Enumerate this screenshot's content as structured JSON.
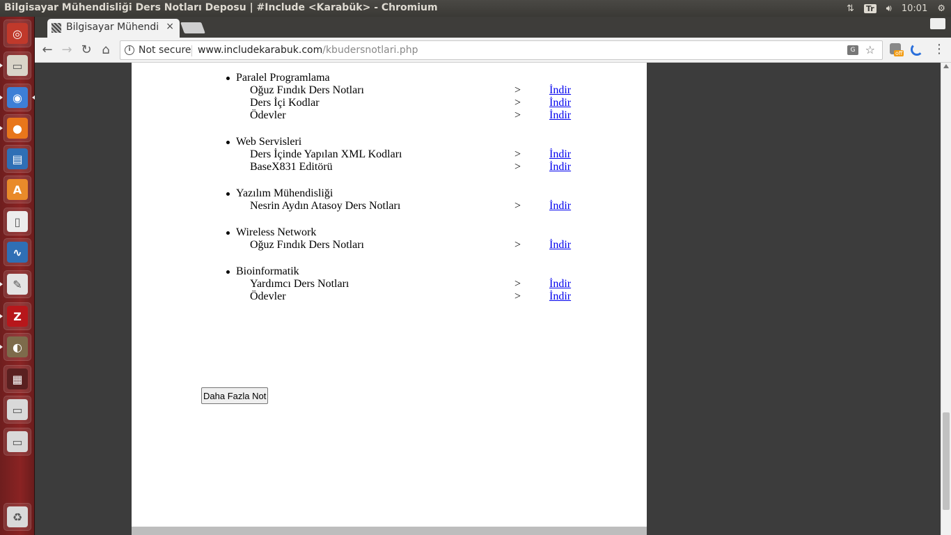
{
  "window": {
    "title": "Bilgisayar Mühendisliği Ders Notları Deposu | #Include <Karabük> - Chromium"
  },
  "system_tray": {
    "keyboard": "Tr",
    "volume_icon": "volume-icon",
    "network_icon": "network-icon",
    "time": "10:01",
    "settings_icon": "gear-icon"
  },
  "launcher": {
    "items": [
      {
        "name": "ubuntu-dash",
        "icon": "ubuntu-logo-icon",
        "color": "#c0392b"
      },
      {
        "name": "files",
        "icon": "files-icon",
        "color": "#d9d4c8"
      },
      {
        "name": "chromium",
        "icon": "chromium-icon",
        "color": "#3d7fd6"
      },
      {
        "name": "firefox",
        "icon": "firefox-icon",
        "color": "#e8761b"
      },
      {
        "name": "libreoffice-writer",
        "icon": "writer-icon",
        "color": "#2f6fb5"
      },
      {
        "name": "software-center",
        "icon": "software-center-icon",
        "color": "#e98a2a"
      },
      {
        "name": "mouse-settings",
        "icon": "mouse-icon",
        "color": "#ececec"
      },
      {
        "name": "system-monitor",
        "icon": "system-monitor-icon",
        "color": "#2f6fb5"
      },
      {
        "name": "text-editor",
        "icon": "text-editor-icon",
        "color": "#e4e4e4"
      },
      {
        "name": "filezilla",
        "icon": "filezilla-icon",
        "color": "#b7171b"
      },
      {
        "name": "gimp",
        "icon": "gimp-icon",
        "color": "#7d6b4b"
      },
      {
        "name": "workspace-switcher",
        "icon": "workspace-icon",
        "color": "#5a2020"
      },
      {
        "name": "drive-1",
        "icon": "drive-icon",
        "color": "#d9d9d9"
      },
      {
        "name": "drive-2",
        "icon": "drive-icon",
        "color": "#d9d9d9"
      },
      {
        "name": "trash",
        "icon": "trash-icon",
        "color": "#d9d9d9"
      }
    ]
  },
  "browser": {
    "tab": {
      "label": "Bilgisayar Mühendi",
      "close": "×"
    },
    "profile": "👤",
    "omnibox": {
      "security": "Not secure",
      "host": "www.includekarabuk.com",
      "path": "/kbudersnotlari.php",
      "translate": "G",
      "star": "☆"
    },
    "extensions": {
      "off_badge": "off"
    },
    "menu": "⋮"
  },
  "content": {
    "categories": [
      {
        "name": "Paralel Programlama",
        "items": [
          {
            "name": "Oğuz Fındık Ders Notları",
            "arrow": ">",
            "link": "İndir"
          },
          {
            "name": "Ders İçi Kodlar",
            "arrow": ">",
            "link": "İndir"
          },
          {
            "name": "Ödevler",
            "arrow": ">",
            "link": "İndir"
          }
        ]
      },
      {
        "name": "Web Servisleri",
        "items": [
          {
            "name": "Ders İçinde Yapılan XML Kodları",
            "arrow": ">",
            "link": "İndir"
          },
          {
            "name": "BaseX831 Editörü",
            "arrow": ">",
            "link": "İndir"
          }
        ]
      },
      {
        "name": "Yazılım Mühendisliği",
        "items": [
          {
            "name": "Nesrin Aydın Atasoy Ders Notları",
            "arrow": ">",
            "link": "İndir"
          }
        ]
      },
      {
        "name": "Wireless Network",
        "items": [
          {
            "name": "Oğuz Fındık Ders Notları",
            "arrow": ">",
            "link": "İndir"
          }
        ]
      },
      {
        "name": "Bioinformatik",
        "items": [
          {
            "name": "Yardımcı Ders Notları",
            "arrow": ">",
            "link": "İndir"
          },
          {
            "name": "Ödevler",
            "arrow": ">",
            "link": "İndir"
          }
        ]
      }
    ],
    "more_button": "Daha Fazla Not"
  }
}
